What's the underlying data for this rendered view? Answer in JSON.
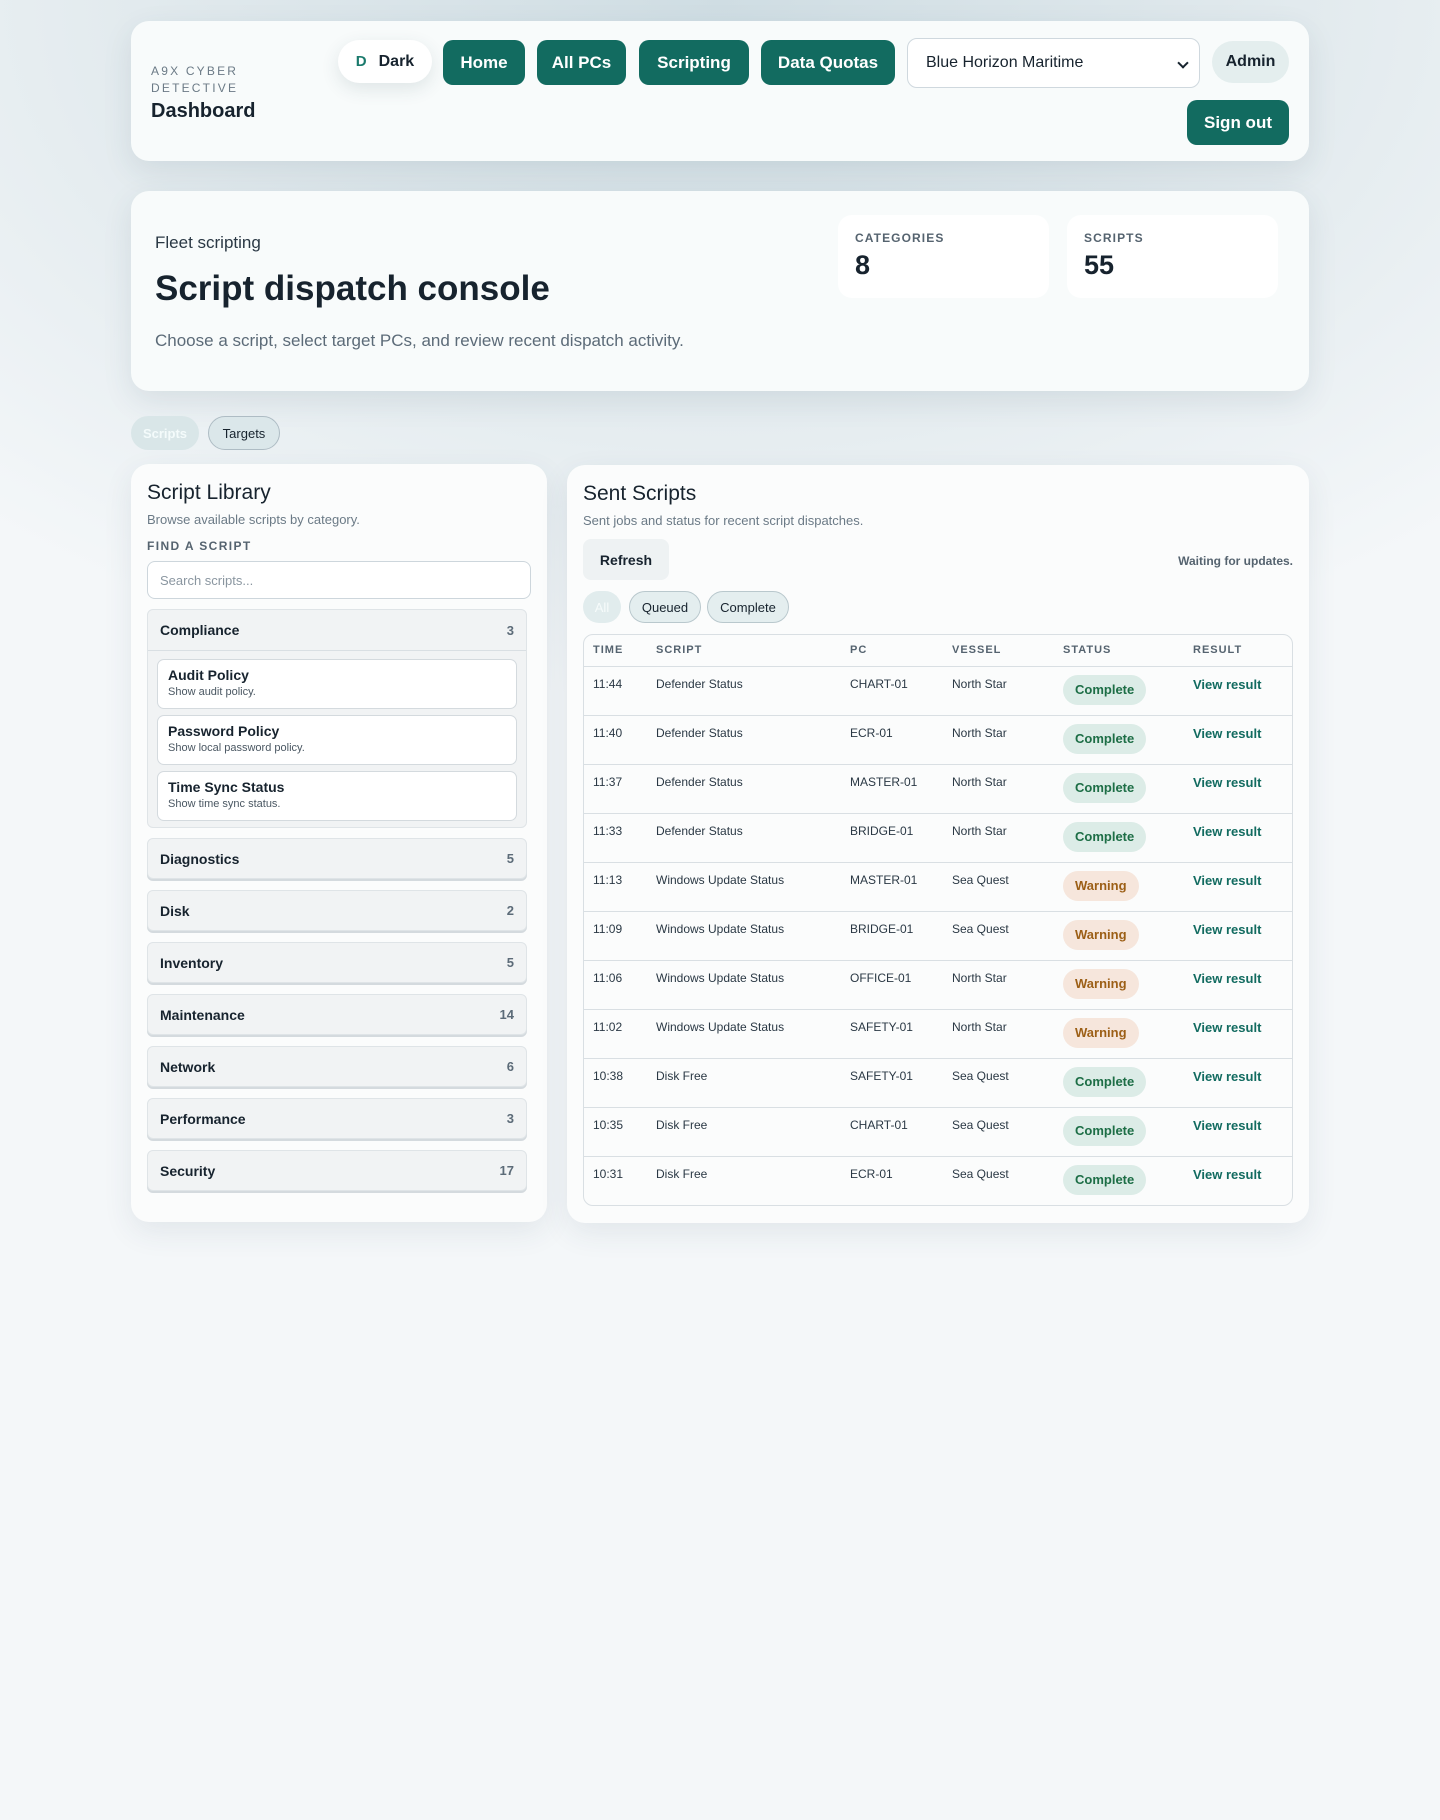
{
  "header": {
    "brand_sub": "A9X CYBER DETECTIVE",
    "brand_title": "Dashboard",
    "theme_letter": "D",
    "theme_label": "Dark",
    "nav": [
      "Home",
      "All PCs",
      "Scripting",
      "Data Quotas"
    ],
    "company": "Blue Horizon Maritime",
    "user_role": "Admin",
    "signout": "Sign out"
  },
  "hero": {
    "eyebrow": "Fleet scripting",
    "title": "Script dispatch console",
    "description": "Choose a script, select target PCs, and review recent dispatch activity.",
    "stats": [
      {
        "label": "CATEGORIES",
        "value": "8"
      },
      {
        "label": "SCRIPTS",
        "value": "55"
      }
    ]
  },
  "tabs": [
    "Scripts",
    "Targets"
  ],
  "library": {
    "title": "Script Library",
    "subtitle": "Browse available scripts by category.",
    "find_label": "FIND A SCRIPT",
    "search_placeholder": "Search scripts...",
    "open_category": {
      "name": "Compliance",
      "count": "3",
      "scripts": [
        {
          "name": "Audit Policy",
          "desc": "Show audit policy."
        },
        {
          "name": "Password Policy",
          "desc": "Show local password policy."
        },
        {
          "name": "Time Sync Status",
          "desc": "Show time sync status."
        }
      ]
    },
    "categories": [
      {
        "name": "Diagnostics",
        "count": "5"
      },
      {
        "name": "Disk",
        "count": "2"
      },
      {
        "name": "Inventory",
        "count": "5"
      },
      {
        "name": "Maintenance",
        "count": "14"
      },
      {
        "name": "Network",
        "count": "6"
      },
      {
        "name": "Performance",
        "count": "3"
      },
      {
        "name": "Security",
        "count": "17"
      }
    ]
  },
  "sent": {
    "title": "Sent Scripts",
    "subtitle": "Sent jobs and status for recent script dispatches.",
    "refresh": "Refresh",
    "waiting": "Waiting for updates.",
    "filters": [
      "All",
      "Queued",
      "Complete"
    ],
    "columns": [
      "TIME",
      "SCRIPT",
      "PC",
      "VESSEL",
      "STATUS",
      "RESULT"
    ],
    "rows": [
      {
        "time": "11:44",
        "script": "Defender Status",
        "pc": "CHART-01",
        "vessel": "North Star",
        "status": "Complete",
        "result": "View result"
      },
      {
        "time": "11:40",
        "script": "Defender Status",
        "pc": "ECR-01",
        "vessel": "North Star",
        "status": "Complete",
        "result": "View result"
      },
      {
        "time": "11:37",
        "script": "Defender Status",
        "pc": "MASTER-01",
        "vessel": "North Star",
        "status": "Complete",
        "result": "View result"
      },
      {
        "time": "11:33",
        "script": "Defender Status",
        "pc": "BRIDGE-01",
        "vessel": "North Star",
        "status": "Complete",
        "result": "View result"
      },
      {
        "time": "11:13",
        "script": "Windows Update Status",
        "pc": "MASTER-01",
        "vessel": "Sea Quest",
        "status": "Warning",
        "result": "View result"
      },
      {
        "time": "11:09",
        "script": "Windows Update Status",
        "pc": "BRIDGE-01",
        "vessel": "Sea Quest",
        "status": "Warning",
        "result": "View result"
      },
      {
        "time": "11:06",
        "script": "Windows Update Status",
        "pc": "OFFICE-01",
        "vessel": "North Star",
        "status": "Warning",
        "result": "View result"
      },
      {
        "time": "11:02",
        "script": "Windows Update Status",
        "pc": "SAFETY-01",
        "vessel": "North Star",
        "status": "Warning",
        "result": "View result"
      },
      {
        "time": "10:38",
        "script": "Disk Free",
        "pc": "SAFETY-01",
        "vessel": "Sea Quest",
        "status": "Complete",
        "result": "View result"
      },
      {
        "time": "10:35",
        "script": "Disk Free",
        "pc": "CHART-01",
        "vessel": "Sea Quest",
        "status": "Complete",
        "result": "View result"
      },
      {
        "time": "10:31",
        "script": "Disk Free",
        "pc": "ECR-01",
        "vessel": "Sea Quest",
        "status": "Complete",
        "result": "View result"
      }
    ]
  },
  "colors": {
    "accent": "#126b60",
    "complete_bg": "#dcece7",
    "complete_text": "#1d6e46",
    "warning_bg": "#f6e6dc",
    "warning_text": "#9c5f16"
  }
}
